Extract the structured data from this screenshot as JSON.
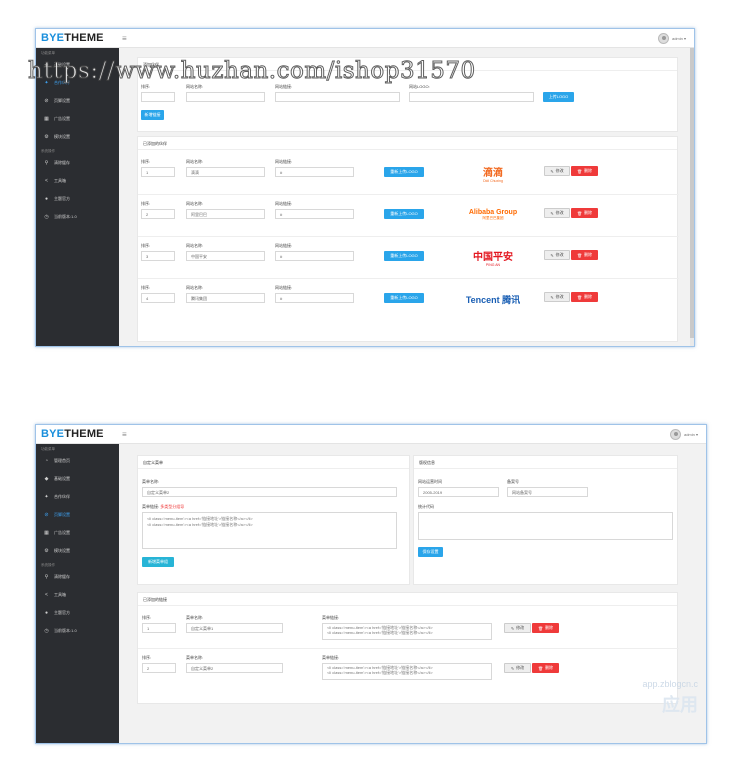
{
  "brand": {
    "part1": "BYE",
    "part2": "THEME"
  },
  "menu_icon": "≡",
  "user": {
    "name": "admin ▾"
  },
  "sidebar": {
    "group1": "功能菜单",
    "group2": "系统操作",
    "items": [
      {
        "label": "管理首页",
        "icon": "◔"
      },
      {
        "label": "基础设置",
        "icon": "◆"
      },
      {
        "label": "合作伙伴",
        "icon": "✦"
      },
      {
        "label": "页脚设置",
        "icon": "⊘"
      },
      {
        "label": "广告设置",
        "icon": "▦"
      },
      {
        "label": "模块设置",
        "icon": "⚙"
      }
    ],
    "sys": [
      {
        "label": "清除缓存",
        "icon": "⚲"
      },
      {
        "label": "工具箱",
        "icon": "<"
      },
      {
        "label": "主题官方",
        "icon": "●"
      },
      {
        "label": "当前版本:1.0",
        "icon": "◷"
      }
    ]
  },
  "screen1": {
    "sidebar_items": [
      "基础设置",
      "合作伙伴",
      "页脚设置",
      "广告设置",
      "模块设置"
    ],
    "add": {
      "title": "添加伙伴",
      "sort_label": "排序:",
      "name_label": "网站名称:",
      "link_label": "网站链接:",
      "logo_label": "网站LOGO:",
      "upload_btn": "上传LOGO",
      "add_btn": "新增链接"
    },
    "list": {
      "title": "已添加的伙伴",
      "sort_label": "排序:",
      "name_label": "网站名称:",
      "link_label": "网站链接:",
      "reupload_btn": "重新上传LOGO",
      "edit_btn": "修改",
      "delete_btn": "删除",
      "rows": [
        {
          "sort": "1",
          "name": "滴滴",
          "link": "#",
          "logo": "滴滴",
          "logo_sub": "Didi Chuxing"
        },
        {
          "sort": "2",
          "name": "阿里巴巴",
          "link": "#",
          "logo": "Alibaba Group",
          "logo_sub": "阿里巴巴集团"
        },
        {
          "sort": "3",
          "name": "中国平安",
          "link": "#",
          "logo": "中国平安",
          "logo_sub": "PING AN"
        },
        {
          "sort": "4",
          "name": "腾讯集团",
          "link": "#",
          "logo": "Tencent 腾讯",
          "logo_sub": ""
        }
      ]
    }
  },
  "screen2": {
    "custom_menu": {
      "title": "自定义菜单",
      "name_label": "菜单名称:",
      "name_placeholder": "自定义菜单2",
      "link_label": "菜单链接:",
      "link_hint": "多类型分组导",
      "textarea_line1": "<li class='menu-item'><a href='链接地址'>链接名称</a></li>",
      "textarea_line2": "<li class='menu-item'><a href='链接地址'>链接名称</a></li>",
      "add_btn": "新增菜单组"
    },
    "copyright": {
      "title": "版权信息",
      "time_label": "网站运营时间",
      "time_value": "2005-2019",
      "icp_label": "备案号",
      "icp_value": "网站备案号",
      "stats_label": "统计代码",
      "save_btn": "保存设置"
    },
    "list": {
      "title": "已添加的链接",
      "sort_label": "排序:",
      "name_label": "菜单名称:",
      "link_label": "菜单链接:",
      "edit_btn": "修改",
      "delete_btn": "删除",
      "rows": [
        {
          "sort": "1",
          "name": "自定义菜单1",
          "line1": "<li class='menu-item'><a href='链接地址'>链接名称</a></li>",
          "line2": "<li class='menu-item'><a href='链接地址'>链接名称</a></li>"
        },
        {
          "sort": "2",
          "name": "自定义菜单2",
          "line1": "<li class='menu-item'><a href='链接地址'>链接名称</a></li>",
          "line2": "<li class='menu-item'><a href='链接地址'>链接名称</a></li>"
        }
      ]
    }
  },
  "watermark1": "https://www.huzhan.com/ishop31570",
  "watermark2": {
    "small": "app.zblogcn.c",
    "big": "应用"
  },
  "colors": {
    "accent": "#1a8fdc",
    "danger": "#ef3a3a",
    "sidebar": "#2b2d31"
  }
}
